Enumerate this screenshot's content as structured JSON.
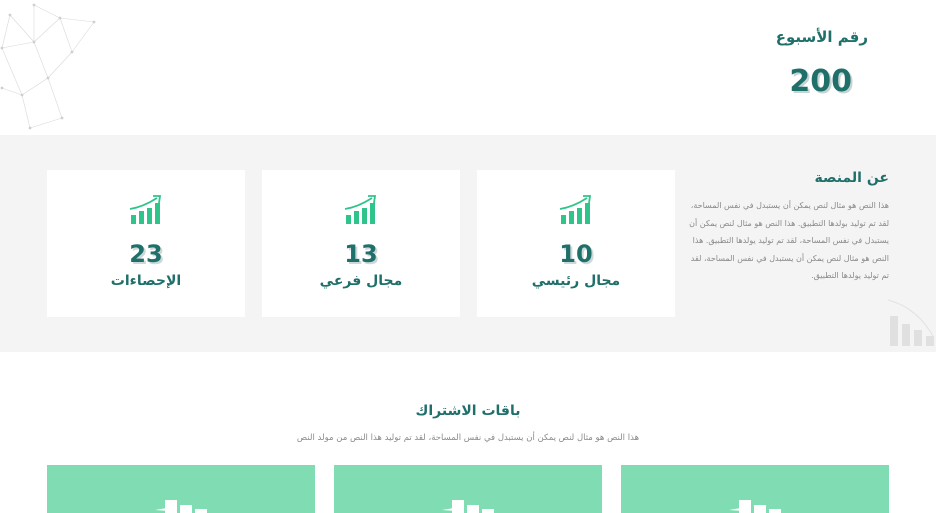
{
  "week": {
    "title": "رقم الأسبوع",
    "value": "200"
  },
  "about": {
    "title": "عن المنصة",
    "text": "هذا النص هو مثال لنص يمكن أن يستبدل في نفس المساحة، لقد تم توليد بولدها التطبيق. هذا النص هو مثال لنص يمكن أن يستبدل في نفس المساحة، لقد تم توليد يولدها التطبيق. هذا النص هو مثال لنص يمكن أن يستبدل في نفس المساحة، لقد تم توليد يولدها التطبيق."
  },
  "stats": [
    {
      "value": "23",
      "label": "الإحصاءات",
      "icon": "growth-chart-icon"
    },
    {
      "value": "13",
      "label": "مجال فرعي",
      "icon": "growth-chart-icon"
    },
    {
      "value": "10",
      "label": "مجال رئيسي",
      "icon": "growth-chart-icon"
    }
  ],
  "subscriptions": {
    "title": "باقات الاشتراك",
    "subtitle": "هذا النص هو مثال لنص يمكن أن يستبدل في نفس المساحة، لقد تم توليد هذا النص من مولد النص",
    "packages": [
      {
        "icon": "package-chart-icon"
      },
      {
        "icon": "package-chart-icon"
      },
      {
        "icon": "package-chart-icon"
      }
    ]
  },
  "colors": {
    "primary": "#1f6f6a",
    "accent_green": "#2ec48a",
    "package_bg": "#80dcb3",
    "band_bg": "#f4f4f4",
    "muted_text": "#8a8a8a"
  }
}
